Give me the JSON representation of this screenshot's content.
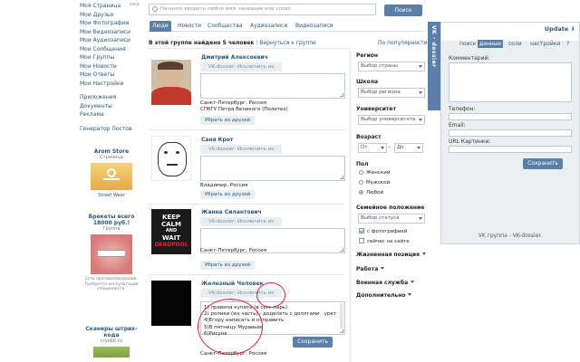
{
  "left_nav": {
    "edit_label": "ред.",
    "items": [
      "Моя Страница",
      "Мои Друзья",
      "Мои Фотографии",
      "Мои Видеозаписи",
      "Мои Аудиозаписи",
      "Мои Сообщения",
      "Мои Группы",
      "Мои Новости",
      "Мои Ответы",
      "Мои Настройки"
    ],
    "items2": [
      "Приложения",
      "Документы",
      "Реклама"
    ],
    "items3": [
      "Генератор Постов"
    ]
  },
  "ads": [
    {
      "title": "Arom Store",
      "subtitle": "Страница",
      "caption": "Street Wear"
    },
    {
      "title": "Брекеты всего 18000 руб.!",
      "subtitle": "Группа",
      "caption": "Есть противопоказания. Требуется консультация специалиста."
    },
    {
      "title": "Сканеры штрих-кода",
      "subtitle": "cryobit.ru"
    }
  ],
  "search": {
    "placeholder": "Начните вводить любое имя, название или слово",
    "button": "Поиск"
  },
  "tabs": [
    "Люди",
    "Новости",
    "Сообщества",
    "Аудиозаписи",
    "Видеозаписи"
  ],
  "summary": {
    "text": "В этой группе найдено 5 человек",
    "back": "Вернуться к группе",
    "sort": "По популярности"
  },
  "people": [
    {
      "name": "Дмитрий Алексеевич",
      "vk_button": "VK-dossier: Исключить из поиска",
      "city": "Санкт-Петербург, Россия",
      "school": "СПбГУ Петра Великого (Политех)",
      "remove": "Убрать из друзей"
    },
    {
      "name": "Саня Крот",
      "vk_button": "VK-dossier: Исключить из поиска",
      "city": "Владимир, Россия",
      "remove": "Убрать из друзей"
    },
    {
      "name": "Жанна Силантович",
      "vk_button": "VK-dossier: Исключить из поиска",
      "city": "Санкт-Петербург, Россия",
      "remove": "Убрать из друзей",
      "poster_lines": [
        "KEEP",
        "CALM",
        "AND",
        "WAIT",
        "DEADPOOL"
      ]
    },
    {
      "name": "Железный Человек",
      "vk_button": "VK-dossier: Исключить из поиска",
      "city": "Санкт-Петербург, Россия",
      "notes": "1) правила купить (в сем. ларь)\n2) ролики (юз часть) - доделать с доллгами   урет\n4)Егору написать и отправить\n5)В пятницу Муравьев\n6)Рисунк",
      "save": "Сохранить"
    }
  ],
  "filters": {
    "region": {
      "title": "Регион",
      "value": "Выбор страны"
    },
    "school": {
      "title": "Школа",
      "value": "Выбор региона"
    },
    "university": {
      "title": "Университет",
      "value": "Выбор университета"
    },
    "age": {
      "title": "Возраст",
      "from": "От",
      "dash": "-",
      "to": "До"
    },
    "sex": {
      "title": "Пол",
      "options": [
        "Женский",
        "Мужской",
        "Любой"
      ],
      "selected": 2
    },
    "marital": {
      "title": "Семейное положение",
      "value": "Выбор статуса"
    },
    "checks": [
      {
        "label": "с фотографией",
        "checked": true
      },
      {
        "label": "сейчас на сайте",
        "checked": false
      }
    ],
    "links": [
      "Жизненная позиция",
      "Работа",
      "Военная служба",
      "Дополнительно"
    ]
  },
  "dossier": {
    "strip_label": "VK - dossier",
    "update": "Update",
    "tabs": [
      "поиск",
      "данные",
      "соли",
      "настройки",
      "?"
    ],
    "active_tab": 1,
    "labels": {
      "comment": "Комментарий:",
      "phone": "Телефон:",
      "email": "Email:",
      "photo_url": "URL Картинки:"
    },
    "save": "Сохранить",
    "footer": "VK группа - VK-dossier."
  },
  "colors": {
    "accent": "#5b7fa6",
    "link": "#2b587a",
    "annotation": "#e0202a"
  }
}
